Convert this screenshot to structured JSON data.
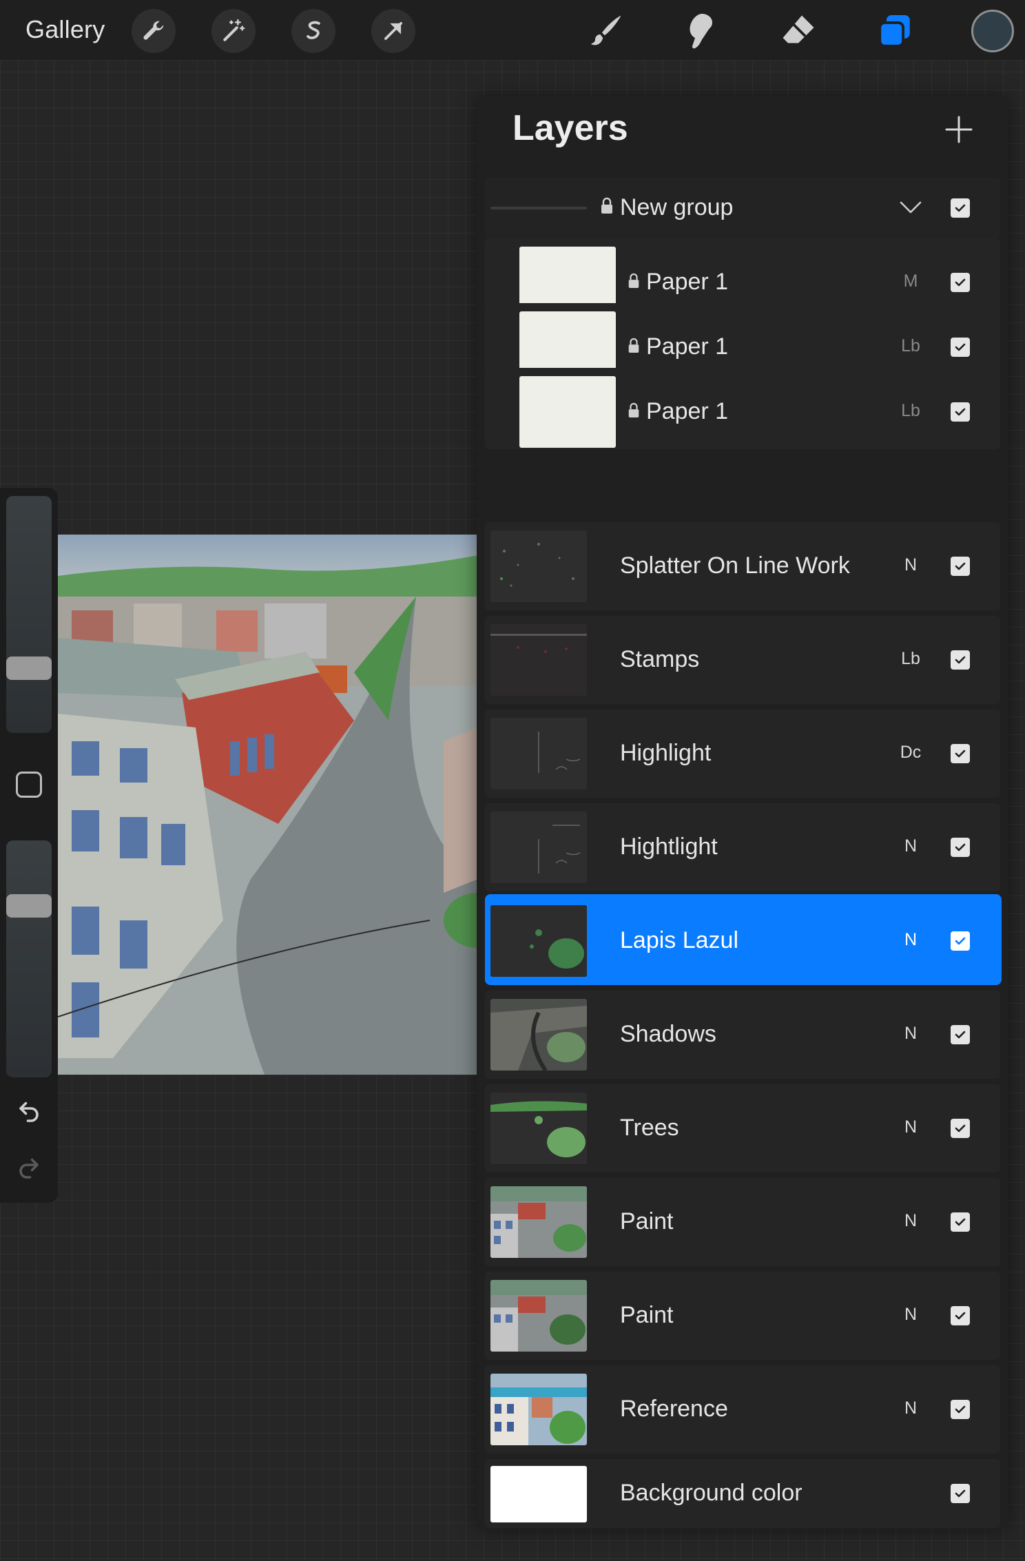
{
  "topbar": {
    "gallery_label": "Gallery",
    "left_tools": [
      "wrench-icon",
      "magic-wand-icon",
      "selection-icon",
      "transform-arrow-icon"
    ],
    "right_tools": [
      "brush-icon",
      "smudge-icon",
      "eraser-icon",
      "layers-icon"
    ],
    "active_tool": "layers-icon",
    "current_color": "#2f3e47",
    "accent_color": "#0a7cff"
  },
  "sidebar": {
    "brush_size_level": 0.25,
    "opacity_level": 0.75,
    "icons": [
      "modify-square-icon",
      "undo-icon",
      "redo-icon"
    ]
  },
  "layers_panel": {
    "title": "Layers",
    "add_icon": "plus-icon",
    "group": {
      "name": "New group",
      "locked": true,
      "expanded": true,
      "visible": true
    },
    "group_children": [
      {
        "name": "Paper 1",
        "blend": "M",
        "locked": true,
        "visible": true
      },
      {
        "name": "Paper 1",
        "blend": "Lb",
        "locked": true,
        "visible": true
      },
      {
        "name": "Paper 1",
        "blend": "Lb",
        "locked": true,
        "visible": true
      }
    ],
    "layers": [
      {
        "name": "Splatter On Line Work",
        "blend": "N",
        "visible": true,
        "selected": false
      },
      {
        "name": "Stamps",
        "blend": "Lb",
        "visible": true,
        "selected": false
      },
      {
        "name": "Highlight",
        "blend": "Dc",
        "visible": true,
        "selected": false
      },
      {
        "name": "Hightlight",
        "blend": "N",
        "visible": true,
        "selected": false
      },
      {
        "name": "Lapis Lazul",
        "blend": "N",
        "visible": true,
        "selected": true
      },
      {
        "name": "Shadows",
        "blend": "N",
        "visible": true,
        "selected": false
      },
      {
        "name": "Trees",
        "blend": "N",
        "visible": true,
        "selected": false
      },
      {
        "name": "Paint",
        "blend": "N",
        "visible": true,
        "selected": false
      },
      {
        "name": "Paint",
        "blend": "N",
        "visible": true,
        "selected": false
      },
      {
        "name": "Reference",
        "blend": "N",
        "visible": true,
        "selected": false
      }
    ],
    "background": {
      "name": "Background color",
      "visible": true,
      "color": "#ffffff"
    }
  }
}
